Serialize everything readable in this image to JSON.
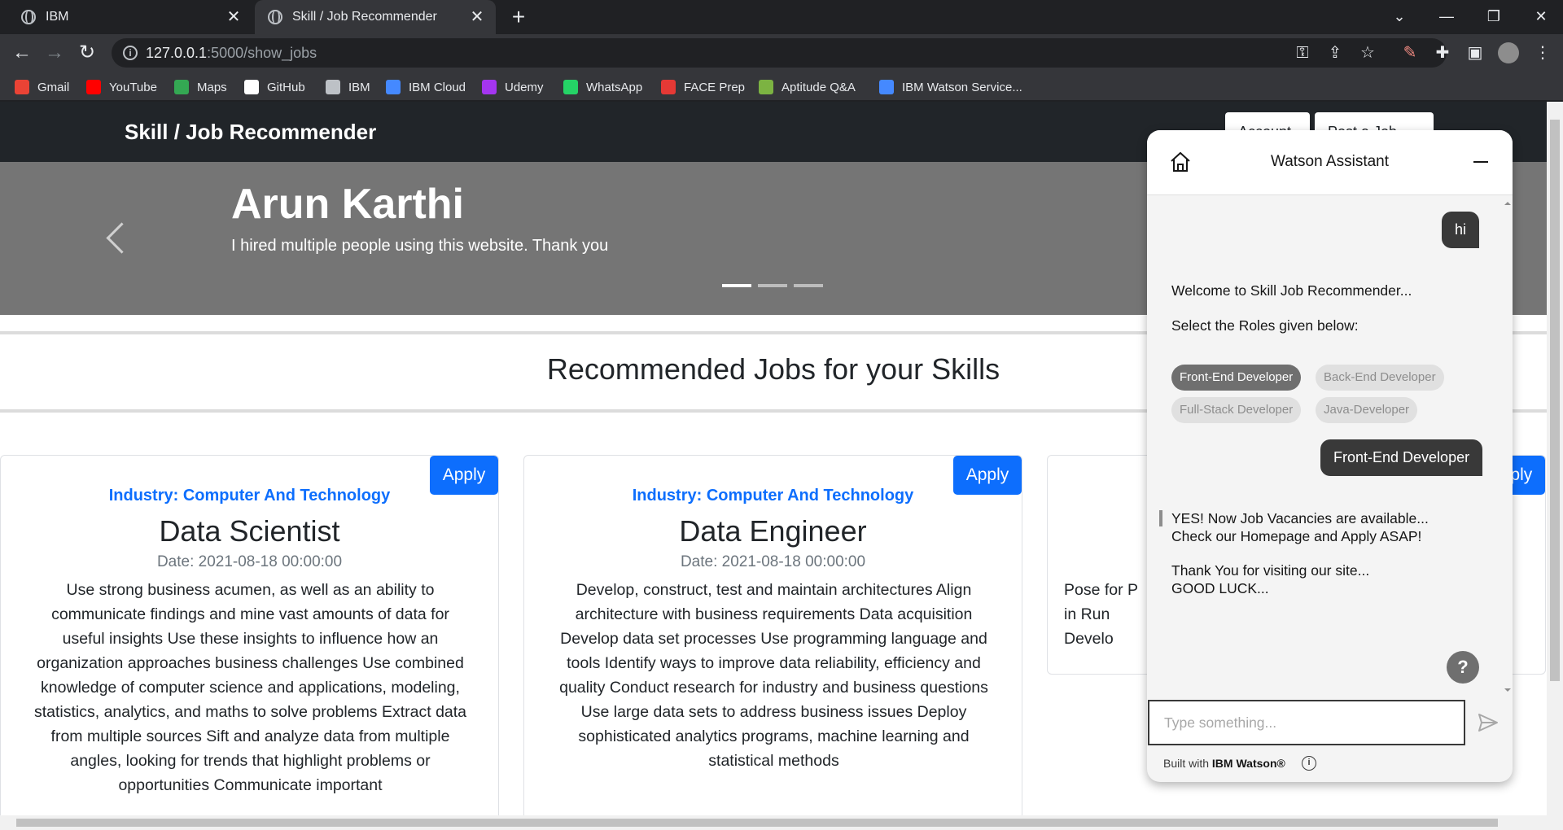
{
  "browser": {
    "tabs": [
      {
        "label": "IBM"
      },
      {
        "label": "Skill / Job Recommender"
      }
    ],
    "url_host": "127.0.0.1",
    "url_rest": ":5000/show_jobs",
    "bookmarks": [
      {
        "label": "Gmail",
        "icon": "gmail-icon",
        "color": "#ea4335"
      },
      {
        "label": "YouTube",
        "icon": "youtube-icon",
        "color": "#ff0000"
      },
      {
        "label": "Maps",
        "icon": "maps-icon",
        "color": "#34a853"
      },
      {
        "label": "GitHub",
        "icon": "github-icon",
        "color": "#ffffff"
      },
      {
        "label": "IBM",
        "icon": "globe-icon",
        "color": "#bdc1c6"
      },
      {
        "label": "IBM Cloud",
        "icon": "ibm-cloud-icon",
        "color": "#4589ff"
      },
      {
        "label": "Udemy",
        "icon": "udemy-icon",
        "color": "#a435f0"
      },
      {
        "label": "WhatsApp",
        "icon": "whatsapp-icon",
        "color": "#25d366"
      },
      {
        "label": "FACE Prep",
        "icon": "faceprep-icon",
        "color": "#e53935"
      },
      {
        "label": "Aptitude Q&A",
        "icon": "aptitude-icon",
        "color": "#7cb342"
      },
      {
        "label": "IBM Watson Service...",
        "icon": "ibm-cloud-icon",
        "color": "#4589ff"
      }
    ]
  },
  "site": {
    "brand": "Skill / Job Recommender",
    "nav_buttons": [
      "Account",
      "Post a Job"
    ],
    "carousel": {
      "title": "Arun Karthi",
      "text": "I hired multiple people using this website. Thank you",
      "slides": 3,
      "active": 0
    },
    "section_title": "Recommended Jobs for your Skills",
    "apply_label": "Apply",
    "jobs": [
      {
        "industry": "Industry: Computer And Technology",
        "title": "Data Scientist",
        "date": "Date: 2021-08-18 00:00:00",
        "description": "Use strong business acumen, as well as an ability to communicate findings and mine vast amounts of data for useful insights Use these insights to influence how an organization approaches business challenges Use combined knowledge of computer science and applications, modeling, statistics, analytics, and maths to solve problems Extract data from multiple sources Sift and analyze data from multiple angles, looking for trends that highlight problems or opportunities Communicate important"
      },
      {
        "industry": "Industry: Computer And Technology",
        "title": "Data Engineer",
        "date": "Date: 2021-08-18 00:00:00",
        "description": "Develop, construct, test and maintain architectures Align architecture with business requirements Data acquisition Develop data set processes Use programming language and tools Identify ways to improve data reliability, efficiency and quality Conduct research for industry and business questions Use large data sets to address business issues Deploy sophisticated analytics programs, machine learning and statistical methods"
      },
      {
        "industry": "",
        "title": "",
        "date": "",
        "description": "Pose for P in Run Develo"
      }
    ]
  },
  "assistant": {
    "title": "Watson Assistant",
    "user_msg_1": "hi",
    "welcome": "Welcome to Skill Job Recommender...",
    "select_prompt": "Select the Roles given below:",
    "options": [
      "Front-End Developer",
      "Back-End Developer",
      "Full-Stack Developer",
      "Java-Developer"
    ],
    "selected_option": "Front-End Developer",
    "user_msg_2": "Front-End Developer",
    "reply_line_1": "YES! Now Job Vacancies are available...",
    "reply_line_2": "Check our Homepage and Apply ASAP!",
    "thanks_line_1": "Thank You for visiting our site...",
    "thanks_line_2": "GOOD LUCK...",
    "help_label": "?",
    "input_placeholder": "Type something...",
    "footer_prefix": "Built with",
    "footer_brand": "IBM Watson®"
  }
}
